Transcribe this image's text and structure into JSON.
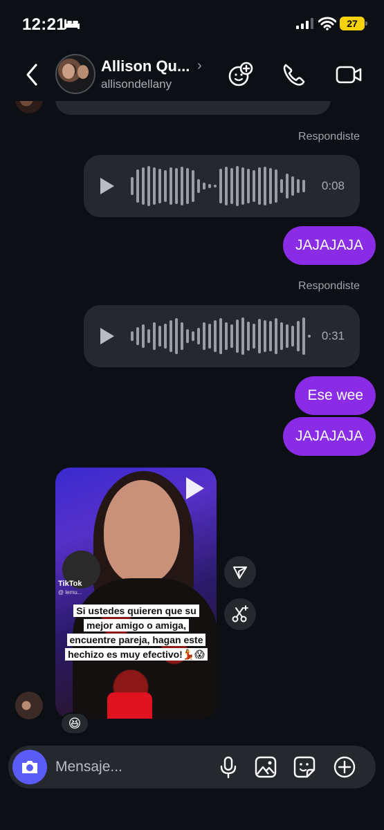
{
  "status": {
    "time": "12:21",
    "battery": "27"
  },
  "header": {
    "name": "Allison Qu...",
    "username": "allisondellany"
  },
  "messages": {
    "replied_1": "Respondiste",
    "voice_1_duration": "0:08",
    "sent_1": "JAJAJAJA",
    "replied_2": "Respondiste",
    "voice_2_duration": "0:31",
    "sent_2": "Ese wee",
    "sent_3": "JAJAJAJA"
  },
  "shared_video": {
    "source": "TikTok",
    "handle": "@ lemu...",
    "caption_lines": [
      "Si ustedes quieren que su",
      "mejor amigo o amiga,",
      "encuentre pareja, hagan este",
      "hechizo es muy efectivo!💃😱"
    ]
  },
  "reaction": "😆",
  "composer": {
    "placeholder": "Mensaje..."
  }
}
